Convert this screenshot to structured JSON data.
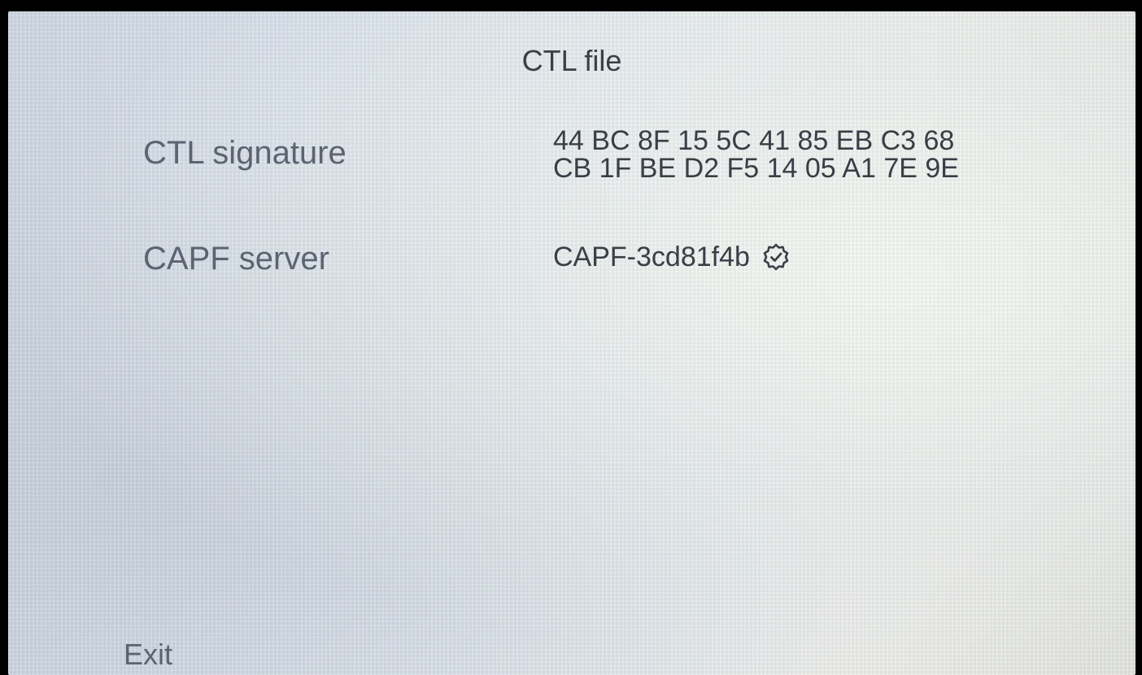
{
  "screen": {
    "title": "CTL file"
  },
  "ctl_signature": {
    "label": "CTL signature",
    "lines": [
      "44 BC 8F 15 5C 41 85 EB C3 68",
      "CB 1F BE D2 F5 14 05 A1 7E 9E"
    ]
  },
  "capf_server": {
    "label": "CAPF server",
    "value": "CAPF-3cd81f4b",
    "status_icon": "verified-check-icon"
  },
  "footer": {
    "exit_label": "Exit"
  }
}
